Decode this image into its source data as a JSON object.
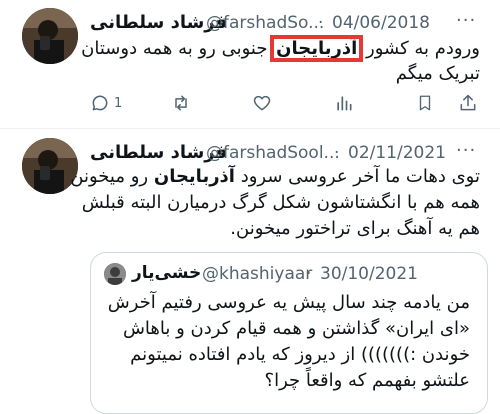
{
  "tweet1": {
    "name": "فرشاد سلطانی",
    "handle": "@farshadSo...",
    "sep": "·",
    "date": "04/06/2018",
    "more": "···",
    "line1_pre": "ورودم به کشور ",
    "line1_highlight": "آذربایجان",
    "line1_post": " جنوبی رو به همه دوستان",
    "line2": "تبریک میگم",
    "actions": {
      "reply_count": "1",
      "retweet_count": "",
      "like_count": "",
      "views_count": ""
    }
  },
  "tweet2": {
    "name": "فرشاد سلطانی",
    "handle": "@farshadSool...",
    "sep": "·",
    "date": "02/11/2021",
    "more": "···",
    "line1_pre": "توی دهات ما آخر عروسی سرود ",
    "line1_bold": "آذربایجان",
    "line1_post": " رو میخونن",
    "line2": "همه هم با انگشتاشون شکل گرگ درمیارن البته قبلش",
    "line3": "هم یه آهنگ برای تراختور میخونن."
  },
  "quote": {
    "name": "خشی‌یار",
    "handle": "@khashiyaar",
    "sep": "·",
    "date": "30/10/2021",
    "line1": "من یادمه چند سال پیش یه عروسی رفتیم آخرش",
    "line2": "«ای ایران» گذاشتن و همه قیام کردن و باهاش",
    "line3": "خوندن :))))))) از دیروز که یادم افتاده نمیتونم",
    "line4": "علتشو بفهمم که واقعاً چرا؟"
  },
  "icons": [
    "reply-icon",
    "retweet-icon",
    "like-icon",
    "views-icon",
    "bookmark-icon",
    "share-icon",
    "more-icon"
  ],
  "colors": {
    "highlight_box": "#e53935",
    "secondary_text": "#536471",
    "divider": "#eff3f4"
  }
}
